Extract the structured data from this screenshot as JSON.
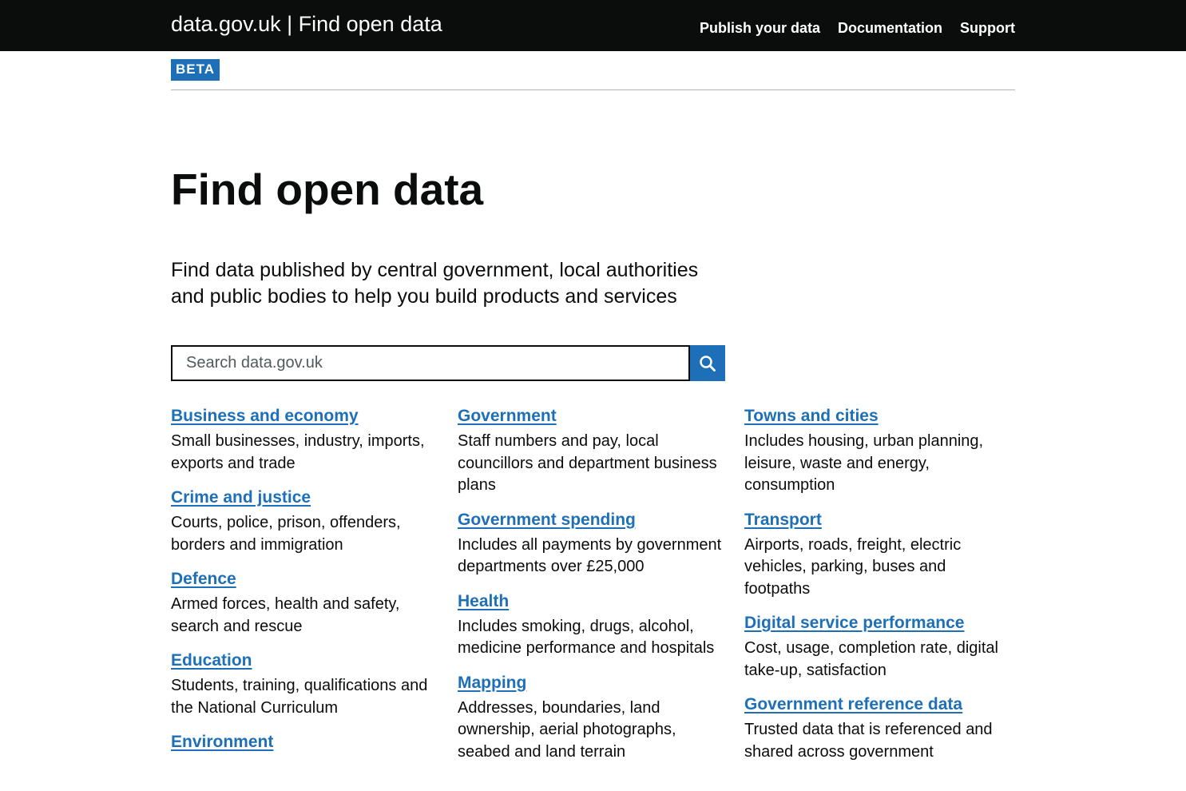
{
  "header": {
    "site_title": "data.gov.uk | Find open data",
    "nav": [
      {
        "label": "Publish your data"
      },
      {
        "label": "Documentation"
      },
      {
        "label": "Support"
      }
    ]
  },
  "phase_banner": {
    "tag": "BETA"
  },
  "main": {
    "title": "Find open data",
    "lede": "Find data published by central government, local authorities and public bodies to help you build products and services",
    "search": {
      "placeholder": "Search data.gov.uk",
      "value": "",
      "icon": "search-icon"
    }
  },
  "topics": {
    "columns": [
      [
        {
          "title": "Business and economy",
          "description": "Small businesses, industry, imports, exports and trade"
        },
        {
          "title": "Crime and justice",
          "description": "Courts, police, prison, offenders, borders and immigration"
        },
        {
          "title": "Defence",
          "description": "Armed forces, health and safety, search and rescue"
        },
        {
          "title": "Education",
          "description": "Students, training, qualifications and the National Curriculum"
        },
        {
          "title": "Environment",
          "description": ""
        }
      ],
      [
        {
          "title": "Government",
          "description": "Staff numbers and pay, local councillors and department business plans"
        },
        {
          "title": "Government spending",
          "description": "Includes all payments by government departments over £25,000"
        },
        {
          "title": "Health",
          "description": "Includes smoking, drugs, alcohol, medicine performance and hospitals"
        },
        {
          "title": "Mapping",
          "description": "Addresses, boundaries, land ownership, aerial photographs, seabed and land terrain"
        }
      ],
      [
        {
          "title": "Towns and cities",
          "description": "Includes housing, urban planning, leisure, waste and energy, consumption"
        },
        {
          "title": "Transport",
          "description": "Airports, roads, freight, electric vehicles, parking, buses and footpaths"
        },
        {
          "title": "Digital service performance",
          "description": "Cost, usage, completion rate, digital take-up, satisfaction"
        },
        {
          "title": "Government reference data",
          "description": "Trusted data that is referenced and shared across government"
        }
      ]
    ]
  },
  "colors": {
    "header_bg": "#0b0c0c",
    "link": "#1d70b8",
    "beta_tag_bg": "#1d70b8",
    "search_button_bg": "#1d70b8"
  }
}
